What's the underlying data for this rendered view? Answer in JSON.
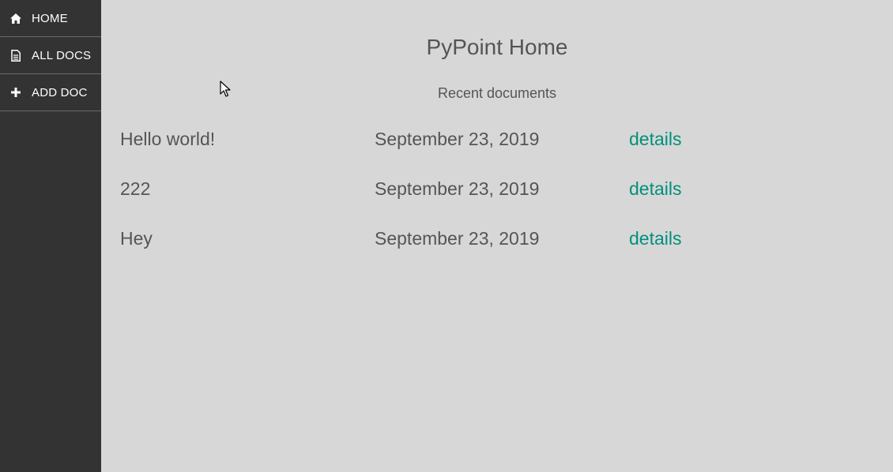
{
  "sidebar": {
    "items": [
      {
        "label": "HOME",
        "icon": "home-icon"
      },
      {
        "label": "ALL DOCS",
        "icon": "document-icon"
      },
      {
        "label": "ADD DOC",
        "icon": "plus-icon"
      }
    ]
  },
  "main": {
    "title": "PyPoint Home",
    "subtitle": "Recent documents",
    "documents": [
      {
        "title": "Hello world!",
        "date": "September 23, 2019",
        "link": "details"
      },
      {
        "title": "222",
        "date": "September 23, 2019",
        "link": "details"
      },
      {
        "title": "Hey",
        "date": "September 23, 2019",
        "link": "details"
      }
    ]
  },
  "colors": {
    "sidebar_bg": "#333333",
    "main_bg": "#d7d7d7",
    "text": "#555555",
    "link": "#00907c"
  }
}
